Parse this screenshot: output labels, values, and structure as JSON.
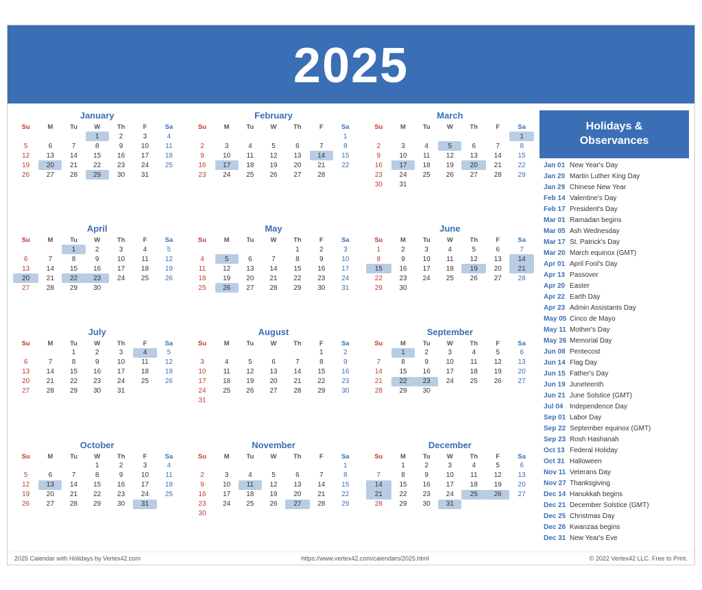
{
  "header": {
    "year": "2025"
  },
  "sidebar": {
    "title": "Holidays &\nObservances",
    "holidays": [
      {
        "date": "Jan 01",
        "name": "New Year's Day"
      },
      {
        "date": "Jan 20",
        "name": "Martin Luther King Day"
      },
      {
        "date": "Jan 29",
        "name": "Chinese New Year"
      },
      {
        "date": "Feb 14",
        "name": "Valentine's Day"
      },
      {
        "date": "Feb 17",
        "name": "President's Day"
      },
      {
        "date": "Mar 01",
        "name": "Ramadan begins"
      },
      {
        "date": "Mar 05",
        "name": "Ash Wednesday"
      },
      {
        "date": "Mar 17",
        "name": "St. Patrick's Day"
      },
      {
        "date": "Mar 20",
        "name": "March equinox (GMT)"
      },
      {
        "date": "Apr 01",
        "name": "April Fool's Day"
      },
      {
        "date": "Apr 13",
        "name": "Passover"
      },
      {
        "date": "Apr 20",
        "name": "Easter"
      },
      {
        "date": "Apr 22",
        "name": "Earth Day"
      },
      {
        "date": "Apr 23",
        "name": "Admin Assistants Day"
      },
      {
        "date": "May 05",
        "name": "Cinco de Mayo"
      },
      {
        "date": "May 11",
        "name": "Mother's Day"
      },
      {
        "date": "May 26",
        "name": "Memorial Day"
      },
      {
        "date": "Jun 08",
        "name": "Pentecost"
      },
      {
        "date": "Jun 14",
        "name": "Flag Day"
      },
      {
        "date": "Jun 15",
        "name": "Father's Day"
      },
      {
        "date": "Jun 19",
        "name": "Juneteenth"
      },
      {
        "date": "Jun 21",
        "name": "June Solstice (GMT)"
      },
      {
        "date": "Jul 04",
        "name": "Independence Day"
      },
      {
        "date": "Sep 01",
        "name": "Labor Day"
      },
      {
        "date": "Sep 22",
        "name": "September equinox (GMT)"
      },
      {
        "date": "Sep 23",
        "name": "Rosh Hashanah"
      },
      {
        "date": "Oct 13",
        "name": "Federal Holiday"
      },
      {
        "date": "Oct 31",
        "name": "Halloween"
      },
      {
        "date": "Nov 11",
        "name": "Veterans Day"
      },
      {
        "date": "Nov 27",
        "name": "Thanksgiving"
      },
      {
        "date": "Dec 14",
        "name": "Hanukkah begins"
      },
      {
        "date": "Dec 21",
        "name": "December Solstice (GMT)"
      },
      {
        "date": "Dec 25",
        "name": "Christmas Day"
      },
      {
        "date": "Dec 26",
        "name": "Kwanzaa begins"
      },
      {
        "date": "Dec 31",
        "name": "New Year's Eve"
      }
    ]
  },
  "footer": {
    "left": "2025 Calendar with Holidays by Vertex42.com",
    "center": "https://www.vertex42.com/calendars/2025.html",
    "right": "© 2022 Vertex42 LLC. Free to Print."
  },
  "months": [
    {
      "name": "January",
      "weeks": [
        [
          null,
          null,
          null,
          "1h",
          "2",
          "3",
          "4s"
        ],
        [
          "5su",
          "6",
          "7",
          "8",
          "9",
          "10",
          "11s"
        ],
        [
          "12su",
          "13",
          "14",
          "15",
          "16",
          "17",
          "18s"
        ],
        [
          "19su",
          "20h",
          "21",
          "22",
          "23",
          "24",
          "25s"
        ],
        [
          "26su",
          "27",
          "28",
          "29h",
          "30",
          "31",
          null
        ]
      ]
    },
    {
      "name": "February",
      "weeks": [
        [
          null,
          null,
          null,
          null,
          null,
          null,
          "1s"
        ],
        [
          "2su",
          "3",
          "4",
          "5",
          "6",
          "7",
          "8s"
        ],
        [
          "9su",
          "10",
          "11",
          "12",
          "13",
          "14h",
          "15s"
        ],
        [
          "16su",
          "17h",
          "18",
          "19",
          "20",
          "21",
          "22s"
        ],
        [
          "23su",
          "24",
          "25",
          "26",
          "27",
          "28",
          null
        ]
      ]
    },
    {
      "name": "March",
      "weeks": [
        [
          null,
          null,
          null,
          null,
          null,
          null,
          "1hs"
        ],
        [
          "2su",
          "3",
          "4",
          "5h",
          "6",
          "7",
          "8s"
        ],
        [
          "9su",
          "10",
          "11",
          "12",
          "13",
          "14",
          "15s"
        ],
        [
          "16su",
          "17h",
          "18",
          "19",
          "20h",
          "21",
          "22s"
        ],
        [
          "23su",
          "24",
          "25",
          "26",
          "27",
          "28",
          "29s"
        ],
        [
          "30su",
          "31",
          null,
          null,
          null,
          null,
          null
        ]
      ]
    },
    {
      "name": "April",
      "weeks": [
        [
          null,
          null,
          "1h",
          "2",
          "3",
          "4",
          "5s"
        ],
        [
          "6su",
          "7",
          "8",
          "9",
          "10",
          "11",
          "12s"
        ],
        [
          "13su",
          "14",
          "15",
          "16",
          "17",
          "18",
          "19s"
        ],
        [
          "20hsu",
          "21",
          "22h",
          "23h",
          "24",
          "25",
          "26s"
        ],
        [
          "27su",
          "28",
          "29",
          "30",
          null,
          null,
          null
        ]
      ]
    },
    {
      "name": "May",
      "weeks": [
        [
          null,
          null,
          null,
          null,
          "1",
          "2",
          "3s"
        ],
        [
          "4su",
          "5h",
          "6",
          "7",
          "8",
          "9",
          "10s"
        ],
        [
          "11su",
          "12",
          "13",
          "14",
          "15",
          "16",
          "17s"
        ],
        [
          "18su",
          "19",
          "20",
          "21",
          "22",
          "23",
          "24s"
        ],
        [
          "25su",
          "26h",
          "27",
          "28",
          "29",
          "30",
          "31s"
        ]
      ]
    },
    {
      "name": "June",
      "weeks": [
        [
          "1su",
          "2",
          "3",
          "4",
          "5",
          "6",
          "7s"
        ],
        [
          "8su",
          "9",
          "10",
          "11",
          "12",
          "13",
          "14hs"
        ],
        [
          "15hsu",
          "16",
          "17",
          "18",
          "19h",
          "20",
          "21hs"
        ],
        [
          "22su",
          "23",
          "24",
          "25",
          "26",
          "27",
          "28s"
        ],
        [
          "29su",
          "30",
          null,
          null,
          null,
          null,
          null
        ]
      ]
    },
    {
      "name": "July",
      "weeks": [
        [
          null,
          null,
          "1",
          "2",
          "3",
          "4h",
          "5s"
        ],
        [
          "6su",
          "7",
          "8",
          "9",
          "10",
          "11",
          "12s"
        ],
        [
          "13su",
          "14",
          "15",
          "16",
          "17",
          "18",
          "19s"
        ],
        [
          "20su",
          "21",
          "22",
          "23",
          "24",
          "25",
          "26s"
        ],
        [
          "27su",
          "28",
          "29",
          "30",
          "31",
          null,
          null
        ]
      ]
    },
    {
      "name": "August",
      "weeks": [
        [
          null,
          null,
          null,
          null,
          null,
          "1",
          "2s"
        ],
        [
          "3su",
          "4",
          "5",
          "6",
          "7",
          "8",
          "9s"
        ],
        [
          "10su",
          "11",
          "12",
          "13",
          "14",
          "15",
          "16s"
        ],
        [
          "17su",
          "18",
          "19",
          "20",
          "21",
          "22",
          "23s"
        ],
        [
          "24su",
          "25",
          "26",
          "27",
          "28",
          "29",
          "30s"
        ],
        [
          "31su",
          null,
          null,
          null,
          null,
          null,
          null
        ]
      ]
    },
    {
      "name": "September",
      "weeks": [
        [
          null,
          "1h",
          "2",
          "3",
          "4",
          "5",
          "6s"
        ],
        [
          "7su",
          "8",
          "9",
          "10",
          "11",
          "12",
          "13s"
        ],
        [
          "14su",
          "15",
          "16",
          "17",
          "18",
          "19",
          "20s"
        ],
        [
          "21su",
          "22h",
          "23h",
          "24",
          "25",
          "26",
          "27s"
        ],
        [
          "28su",
          "29",
          "30",
          null,
          null,
          null,
          null
        ]
      ]
    },
    {
      "name": "October",
      "weeks": [
        [
          null,
          null,
          null,
          "1",
          "2",
          "3",
          "4s"
        ],
        [
          "5su",
          "6",
          "7",
          "8",
          "9",
          "10",
          "11s"
        ],
        [
          "12su",
          "13h",
          "14",
          "15",
          "16",
          "17",
          "18s"
        ],
        [
          "19su",
          "20",
          "21",
          "22",
          "23",
          "24",
          "25s"
        ],
        [
          "26su",
          "27",
          "28",
          "29",
          "30",
          "31h",
          null
        ]
      ]
    },
    {
      "name": "November",
      "weeks": [
        [
          null,
          null,
          null,
          null,
          null,
          null,
          "1s"
        ],
        [
          "2su",
          "3",
          "4",
          "5",
          "6",
          "7",
          "8s"
        ],
        [
          "9su",
          "10",
          "11h",
          "12",
          "13",
          "14",
          "15s"
        ],
        [
          "16su",
          "17",
          "18",
          "19",
          "20",
          "21",
          "22s"
        ],
        [
          "23su",
          "24",
          "25",
          "26",
          "27h",
          "28",
          "29s"
        ],
        [
          "30su",
          null,
          null,
          null,
          null,
          null,
          null
        ]
      ]
    },
    {
      "name": "December",
      "weeks": [
        [
          null,
          "1",
          "2",
          "3",
          "4",
          "5",
          "6s"
        ],
        [
          "7su",
          "8",
          "9",
          "10",
          "11",
          "12",
          "13s"
        ],
        [
          "14hsu",
          "15",
          "16",
          "17",
          "18",
          "19",
          "20s"
        ],
        [
          "21hsu",
          "22",
          "23",
          "24",
          "25h",
          "26h",
          "27s"
        ],
        [
          "28su",
          "29",
          "30",
          "31h",
          null,
          null,
          null
        ]
      ]
    }
  ]
}
